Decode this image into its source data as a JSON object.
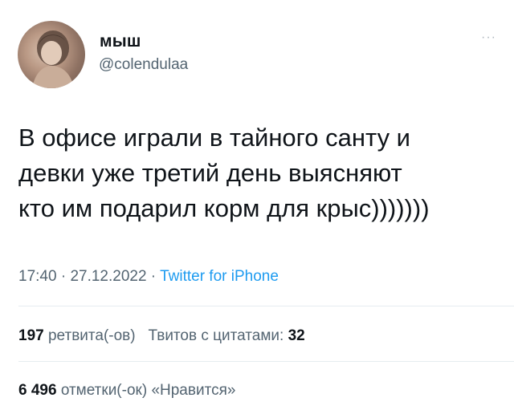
{
  "author": {
    "display_name": "мыш",
    "handle": "@colendulaa",
    "avatar_icon": "avatar-photo"
  },
  "more_menu": "···",
  "tweet": {
    "lines": [
      "В офисе играли в тайного санту и",
      "девки уже третий день выясняют",
      "кто им подарил корм для крыс)))))))"
    ]
  },
  "meta": {
    "time": "17:40",
    "sep1": " · ",
    "date": "27.12.2022",
    "sep2": " · ",
    "source": "Twitter for iPhone"
  },
  "stats": {
    "retweets_count": "197",
    "retweets_label": "ретвита(-ов)",
    "quotes_label": "Твитов с цитатами:",
    "quotes_count": "32",
    "likes_count": "6 496",
    "likes_label": "отметки(-ок) «Нравится»"
  },
  "colors": {
    "text": "#0f1419",
    "secondary": "#536471",
    "link": "#1d9bf0",
    "divider": "#e6ecf0"
  }
}
